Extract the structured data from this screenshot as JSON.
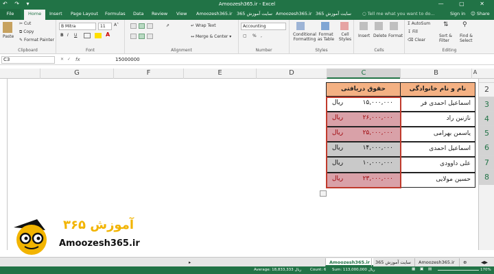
{
  "window": {
    "title": "Amoozesh365.ir - Excel",
    "qat": "↶ ↷ ▾",
    "controls": "— ▢ ✕"
  },
  "tabs": [
    "File",
    "Home",
    "Insert",
    "Page Layout",
    "Formulas",
    "Data",
    "Review",
    "View",
    "Amoozesh365.ir",
    "سایت آموزش 365",
    "Amoozesh365.ir",
    "سایت آموزش 365"
  ],
  "tell_me": "Tell me what you want to do...",
  "signin": "Sign in",
  "share": "Share",
  "ribbon": {
    "clipboard": {
      "label": "Clipboard",
      "paste": "Paste",
      "cut": "Cut",
      "copy": "Copy",
      "format_painter": "Format Painter"
    },
    "font": {
      "label": "Font",
      "name": "B Mitra",
      "size": "11",
      "bold": "B",
      "italic": "I",
      "underline": "U",
      "grow": "A˄",
      "shrink": "A˅"
    },
    "alignment": {
      "label": "Alignment",
      "wrap": "Wrap Text",
      "merge": "Merge & Center"
    },
    "number": {
      "label": "Number",
      "format": "Accounting",
      "pct": "%",
      "comma": ","
    },
    "styles": {
      "label": "Styles",
      "conditional": "Conditional Formatting",
      "table": "Format as Table",
      "cell": "Cell Styles"
    },
    "cells": {
      "label": "Cells",
      "insert": "Insert",
      "delete": "Delete",
      "format": "Format"
    },
    "editing": {
      "label": "Editing",
      "autosum": "AutoSum",
      "fill": "Fill",
      "clear": "Clear",
      "sort": "Sort & Filter",
      "find": "Find & Select"
    }
  },
  "formula_bar": {
    "name_box": "C3",
    "fx": "fx",
    "value": "15000000"
  },
  "columns": [
    "G",
    "F",
    "E",
    "D",
    "C",
    "B",
    "A"
  ],
  "rows": [
    "2",
    "3",
    "4",
    "5",
    "6",
    "7",
    "8"
  ],
  "table": {
    "header_name": "نام و نام خانوادگی",
    "header_salary": "حقوق دریافتی",
    "currency": "ریال",
    "rows": [
      {
        "name": "اسماعیل احمدی فر",
        "amount": "۱۵,۰۰۰,۰۰۰",
        "style": "white"
      },
      {
        "name": "نازنین راد",
        "amount": "۲۶,۰۰۰,۰۰۰",
        "style": "red"
      },
      {
        "name": "یاسمن بهرامی",
        "amount": "۲۵,۰۰۰,۰۰۰",
        "style": "red"
      },
      {
        "name": "اسماعیل احمدی",
        "amount": "۱۴,۰۰۰,۰۰۰",
        "style": "gray"
      },
      {
        "name": "علی داوودی",
        "amount": "۱۰,۰۰۰,۰۰۰",
        "style": "gray"
      },
      {
        "name": "حسین مولایی",
        "amount": "۲۳,۰۰۰,۰۰۰",
        "style": "red"
      }
    ]
  },
  "logo": {
    "text_fa": "آموزش ۳۶۵",
    "url": "Amoozesh365.ir"
  },
  "sheet_tabs": [
    "Amoozesh365.ir",
    "سایت آموزش 365",
    "Amoozesh365.ir"
  ],
  "status": {
    "average": "Average: 18,833,333 ریال",
    "count": "Count: 6",
    "sum": "Sum: 113,000,000 ریال",
    "zoom": "170%"
  },
  "colors": {
    "excel_green": "#217346",
    "header_fill": "#f4b183",
    "red_fill": "#d9a1a8",
    "gray_fill": "#c9c9c9",
    "selection": "#c0392b"
  }
}
